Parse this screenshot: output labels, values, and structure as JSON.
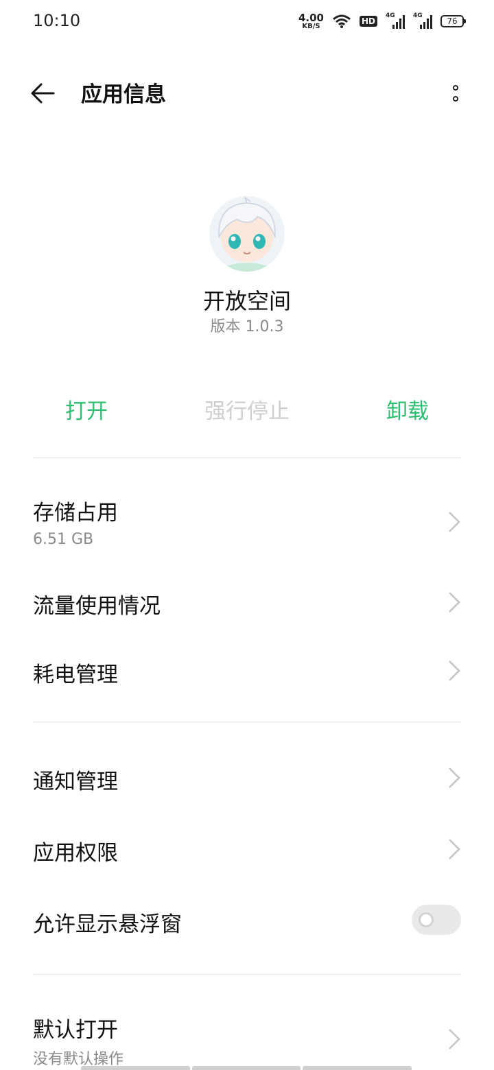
{
  "status_bar": {
    "time": "10:10",
    "net_speed_value": "4.00",
    "net_speed_unit": "KB/S",
    "hd_label": "HD",
    "signal_label": "4G",
    "battery_level": "76"
  },
  "header": {
    "title": "应用信息",
    "back_icon": "back-arrow-icon",
    "more_icon": "more-vertical-icon"
  },
  "app": {
    "name": "开放空间",
    "version": "版本 1.0.3"
  },
  "actions": {
    "open_label": "打开",
    "force_stop_label": "强行停止",
    "uninstall_label": "卸载",
    "accent_color": "#2fbf71",
    "disabled_color": "#cfcfcf"
  },
  "settings": {
    "storage_title": "存储占用",
    "storage_value": "6.51 GB",
    "data_usage_title": "流量使用情况",
    "battery_title": "耗电管理",
    "notifications_title": "通知管理",
    "permissions_title": "应用权限",
    "floating_window_title": "允许显示悬浮窗",
    "floating_window_enabled": false,
    "default_open_title": "默认打开",
    "default_open_sub": "没有默认操作"
  }
}
